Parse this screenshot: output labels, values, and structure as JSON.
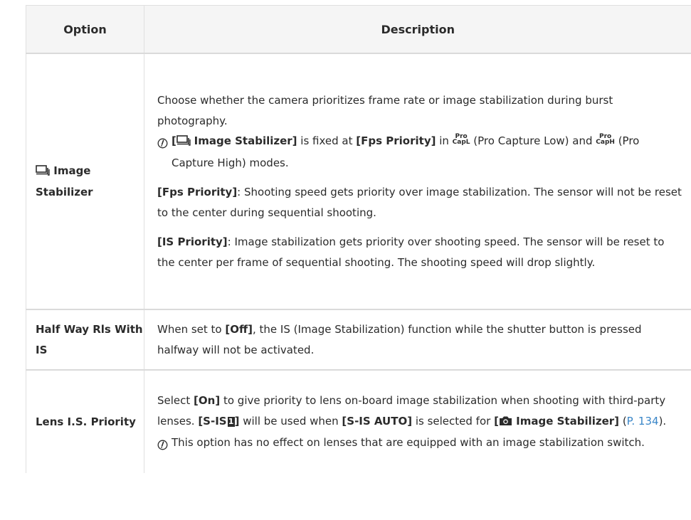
{
  "table": {
    "headers": {
      "option": "Option",
      "description": "Description"
    },
    "rows": [
      {
        "option": "Image Stabilizer",
        "intro": "Choose whether the camera prioritizes frame rate or image stabilization during burst photography.",
        "note": {
          "open_bracket": "[",
          "setting": "Image Stabilizer]",
          "is_fixed_at": " is fixed at ",
          "value": "[Fps Priority]",
          "in": " in ",
          "mode_low_icon": {
            "top": "Pro",
            "bottom": "CapL"
          },
          "mode_low": " (Pro Capture Low)",
          "and": " and ",
          "mode_high_icon": {
            "top": "Pro",
            "bottom": "CapH"
          },
          "mode_high": " (Pro Capture High) modes."
        },
        "fps": {
          "label": "[Fps Priority]",
          "text": ": Shooting speed gets priority over image stabilization. The sensor will not be reset to the center during sequential shooting."
        },
        "is": {
          "label": "[IS Priority]",
          "text": ": Image stabilization gets priority over shooting speed. The sensor will be reset to the center per frame of sequential shooting. The shooting speed will drop slightly."
        }
      },
      {
        "option": "Half Way Rls With IS",
        "pre": "When set to ",
        "value": "[Off]",
        "post": ", the IS (Image Stabilization) function while the shutter button is pressed halfway will not be activated."
      },
      {
        "option": "Lens I.S. Priority",
        "s1": "Select ",
        "on": "[On]",
        "s2": " to give priority to lens on-board image stabilization when shooting with third-party lenses. ",
        "sis": "[S-IS",
        "sis_num": "1",
        "sis_close": "]",
        "s3": " will be used when ",
        "sis_auto": "[S-IS AUTO]",
        "s4": " is selected for ",
        "menu_open": "[",
        "menu": " Image Stabilizer]",
        "s5": " (",
        "link": "P. 134",
        "s6": ").",
        "note": "This option has no effect on lenses that are equipped with an image stabilization switch."
      }
    ]
  },
  "icons": {
    "sequential": "sequential-shooting-icon",
    "caution": "caution-icon",
    "camera": "camera-icon"
  },
  "colors": {
    "link": "#3a86c8",
    "text": "#2b2b2b",
    "header_bg": "#f5f5f5"
  }
}
